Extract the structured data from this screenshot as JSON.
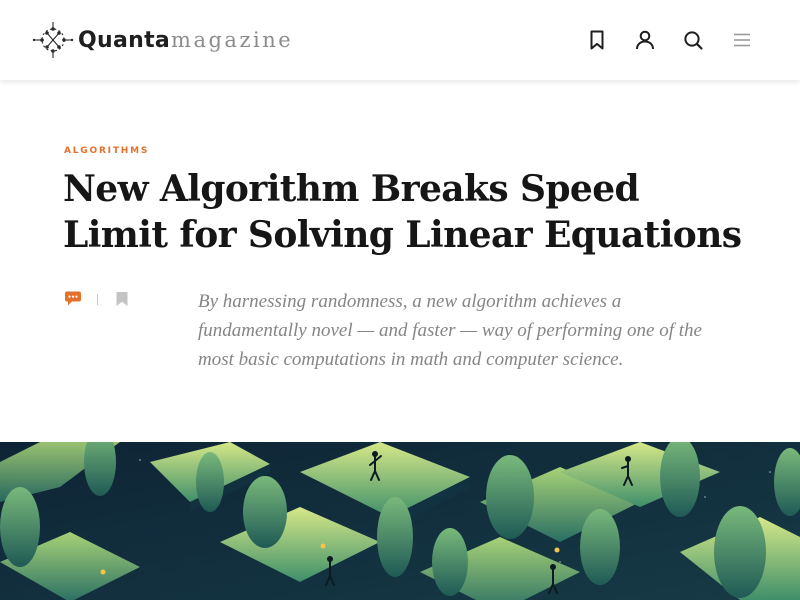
{
  "header": {
    "logo": {
      "primary": "Quanta",
      "secondary": "magazine"
    },
    "icons": [
      "bookmark-icon",
      "user-icon",
      "search-icon",
      "menu-icon"
    ]
  },
  "article": {
    "kicker": "ALGORITHMS",
    "title": "New Algorithm Breaks Speed Limit for Solving Linear Equations",
    "dek": "By harnessing randomness, a new algorithm achieves a fundamentally novel — and faster — way of performing one of the most basic computations in math and computer science.",
    "meta_icons": [
      "comment-icon",
      "bookmark-icon"
    ]
  },
  "colors": {
    "accent": "#e4712b",
    "title": "#161616",
    "dek": "#858585",
    "hero_dark": "#0f2a3a",
    "hero_light": "#c8e07a"
  }
}
